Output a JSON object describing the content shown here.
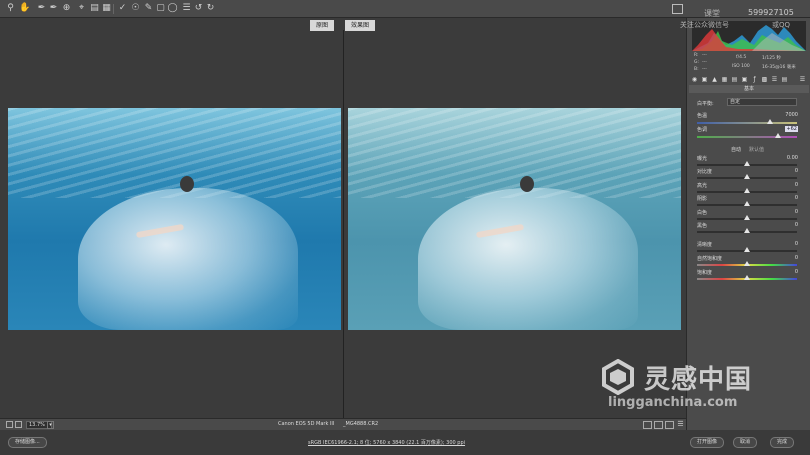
{
  "toolbar": {
    "tools": [
      "zoom-icon",
      "hand-icon",
      "white-balance-icon",
      "color-sampler-icon",
      "target-adjust-icon",
      "crop-icon",
      "straighten-icon",
      "transform-icon",
      "spot-removal-icon",
      "red-eye-icon",
      "adjustment-brush-icon",
      "graduated-filter-icon",
      "radial-filter-icon",
      "preferences-icon",
      "rotate-left-icon",
      "rotate-right-icon"
    ]
  },
  "compare": {
    "before_label": "原图",
    "after_label": "效果图"
  },
  "bottom_bar": {
    "zoom": "13.7%",
    "camera": "Canon EOS 5D Mark III",
    "filename": "_MG4888.CR2"
  },
  "footer": {
    "save_image": "存储图像...",
    "workflow": "sRGB IEC61966-2.1; 8 位; 5760 x 3840 (22.1 百万像素); 300 ppi",
    "open_image": "打开图像",
    "cancel": "取消",
    "done": "完成"
  },
  "panel": {
    "camera_info": {
      "r_label": "R:",
      "r_value": "---",
      "g_label": "G:",
      "g_value": "---",
      "b_label": "B:",
      "b_value": "---",
      "aperture": "f/4.5",
      "shutter": "1/125 秒",
      "iso": "ISO 100",
      "lens": "16-35@16 毫米"
    },
    "section_title": "基本",
    "white_balance_label": "白平衡:",
    "white_balance_value": "自定",
    "temperature_label": "色温",
    "temperature_value": "7000",
    "tint_label": "色调",
    "tint_value": "+62",
    "auto": "自动",
    "default": "默认值",
    "exposure_label": "曝光",
    "exposure_value": "0.00",
    "contrast_label": "对比度",
    "contrast_value": "0",
    "highlights_label": "高光",
    "highlights_value": "0",
    "shadows_label": "阴影",
    "shadows_value": "0",
    "whites_label": "白色",
    "whites_value": "0",
    "blacks_label": "黑色",
    "blacks_value": "0",
    "clarity_label": "清晰度",
    "clarity_value": "0",
    "vibrance_label": "自然饱和度",
    "vibrance_value": "0",
    "saturation_label": "饱和度",
    "saturation_value": "0"
  },
  "watermarks": {
    "top_line1": "599927105",
    "top_line2": "关注公众微信号",
    "top_line3": "或QQ",
    "top_brand": "课堂",
    "bottom_brand": "灵感中国",
    "bottom_url": "lingganchina.com"
  }
}
